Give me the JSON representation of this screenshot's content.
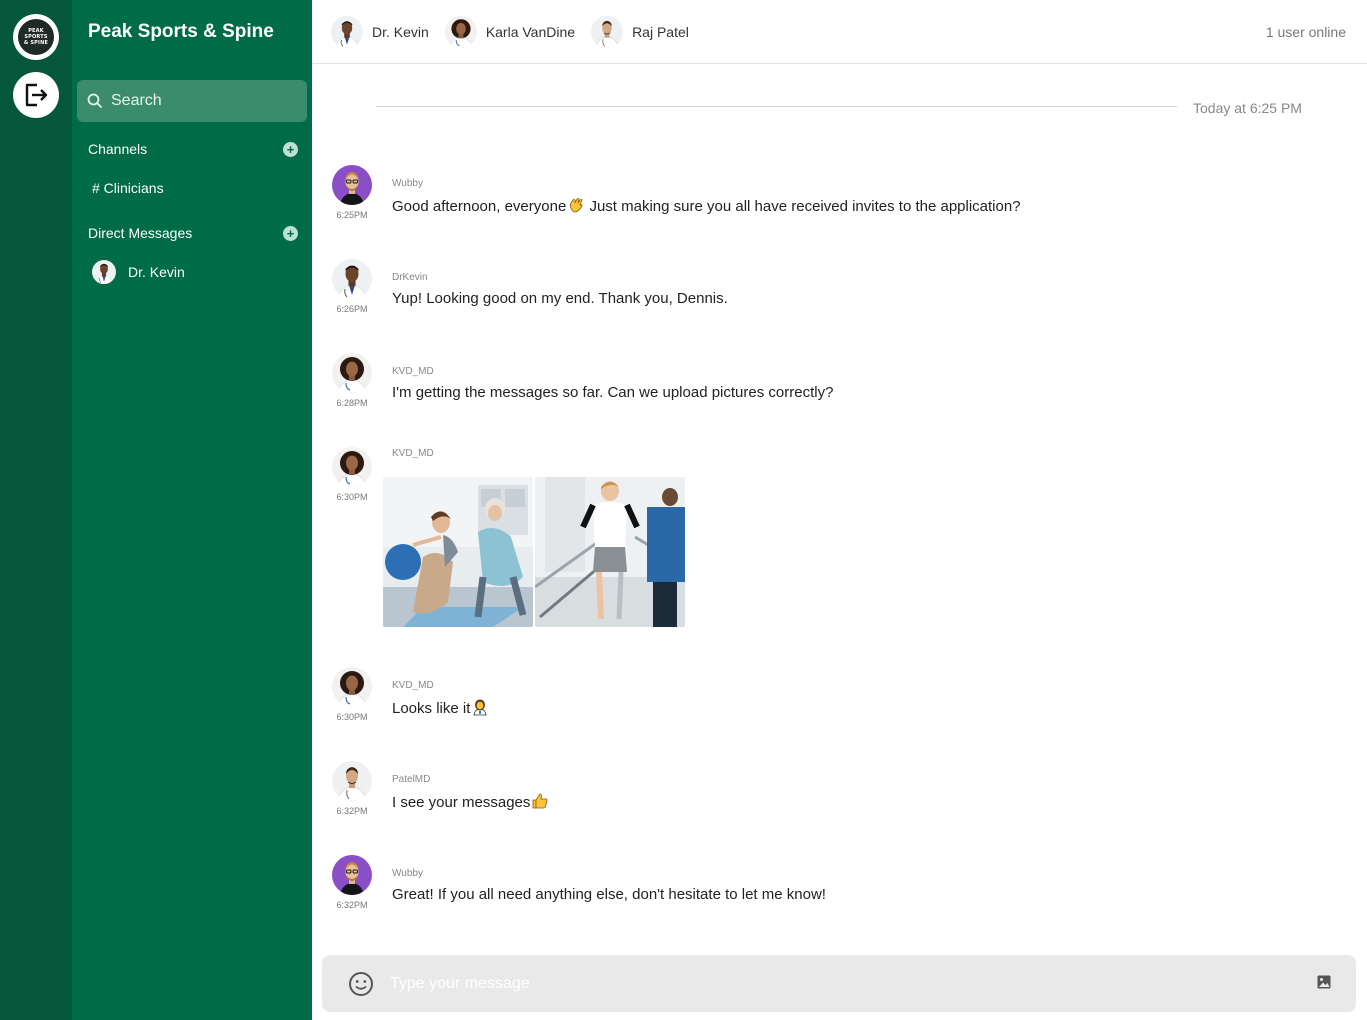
{
  "rail": {
    "logo_text_line1": "PEAK",
    "logo_text_line2": "SPORTS",
    "logo_text_line3": "& SPINE"
  },
  "sidebar": {
    "team_name": "Peak Sports & Spine",
    "search_label": "Search",
    "channels_header": "Channels",
    "channels": [
      {
        "label": "# Clinicians"
      }
    ],
    "dms_header": "Direct Messages",
    "dms": [
      {
        "label": "Dr. Kevin"
      }
    ]
  },
  "topbar": {
    "members": [
      {
        "name": "Dr. Kevin"
      },
      {
        "name": "Karla VanDine"
      },
      {
        "name": "Raj Patel"
      }
    ],
    "online_status": "1 user online"
  },
  "chat": {
    "date_divider": "Today at 6:25 PM",
    "messages": [
      {
        "author": "Wubby",
        "time": "6:25PM",
        "text": "Good afternoon, everyone",
        "text_after": " Just making sure you all have received invites to the application?",
        "emoji": "waving-hand"
      },
      {
        "author": "DrKevin",
        "time": "6:26PM",
        "text": "Yup! Looking good on my end. Thank you, Dennis."
      },
      {
        "author": "KVD_MD",
        "time": "6:28PM",
        "text": "I'm getting the messages so far. Can we upload pictures correctly?"
      },
      {
        "author": "KVD_MD",
        "time": "6:30PM",
        "images": [
          "physical-therapy-photo",
          "gait-training-photo"
        ]
      },
      {
        "author": "KVD_MD",
        "time": "6:30PM",
        "text": "Looks like it",
        "emoji": "health-worker"
      },
      {
        "author": "PatelMD",
        "time": "6:32PM",
        "text": "I see your messages",
        "emoji": "thumbs-up"
      },
      {
        "author": "Wubby",
        "time": "6:32PM",
        "text": "Great! If you all need anything else, don't hesitate to let me know!"
      }
    ]
  },
  "composer": {
    "placeholder": "Type your message"
  },
  "icons": {
    "logout": "logout-icon",
    "search": "search-icon",
    "emoji": "smiley-icon",
    "image": "image-icon"
  },
  "colors": {
    "rail": "#04573a",
    "sidebar": "#006b47",
    "search_bg": "#3b8b6d",
    "composer_bg": "#e9e9e9"
  }
}
